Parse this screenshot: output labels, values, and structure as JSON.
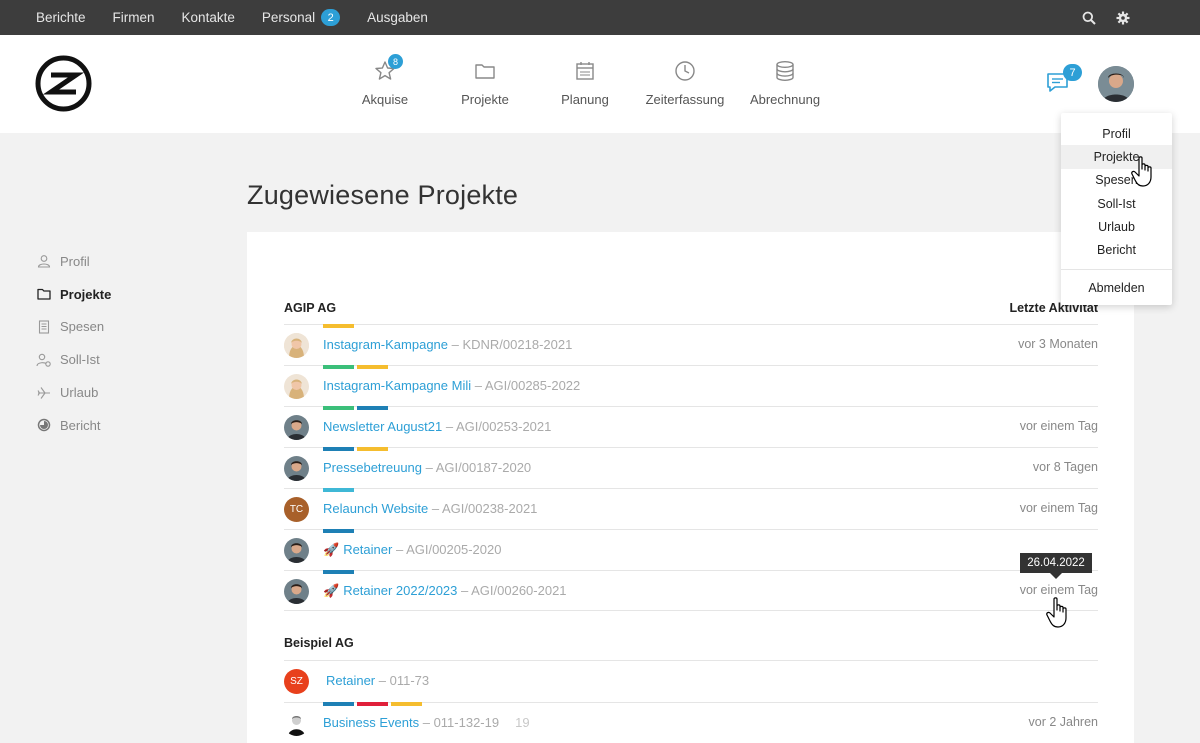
{
  "topnav": {
    "items": [
      {
        "label": "Berichte"
      },
      {
        "label": "Firmen"
      },
      {
        "label": "Kontakte"
      },
      {
        "label": "Personal",
        "badge": "2"
      },
      {
        "label": "Ausgaben"
      }
    ],
    "icons": [
      "search-icon",
      "gear-icon"
    ]
  },
  "mainnav": {
    "items": [
      {
        "label": "Akquise",
        "icon": "star-icon",
        "badge": "8"
      },
      {
        "label": "Projekte",
        "icon": "folder-icon"
      },
      {
        "label": "Planung",
        "icon": "calendar-icon"
      },
      {
        "label": "Zeiterfassung",
        "icon": "clock-icon"
      },
      {
        "label": "Abrechnung",
        "icon": "database-icon"
      }
    ]
  },
  "chat": {
    "badge": "7"
  },
  "sidebar": {
    "items": [
      {
        "label": "Profil",
        "icon": "user-icon"
      },
      {
        "label": "Projekte",
        "icon": "folder-icon",
        "active": true
      },
      {
        "label": "Spesen",
        "icon": "receipt-icon"
      },
      {
        "label": "Soll-Ist",
        "icon": "user-settings-icon"
      },
      {
        "label": "Urlaub",
        "icon": "plane-icon"
      },
      {
        "label": "Bericht",
        "icon": "pie-chart-icon"
      }
    ]
  },
  "page": {
    "title": "Zugewiesene Projekte"
  },
  "groups": [
    {
      "name": "AGIP AG",
      "activity_header": "Letzte Aktivität",
      "rows": [
        {
          "title": "Instagram-Kampagne",
          "ref": " – KDNR/00218-2021",
          "activity": "vor 3 Monaten",
          "avatar": "woman-blonde",
          "tags": [
            "#f5bd2e"
          ]
        },
        {
          "title": "Instagram-Kampagne Mili",
          "ref": " – AGI/00285-2022",
          "activity": "",
          "avatar": "woman-blonde",
          "tags": [
            "#3bbf7a",
            "#f5bd2e"
          ]
        },
        {
          "title": "Newsletter August21",
          "ref": " – AGI/00253-2021",
          "activity": "vor einem Tag",
          "avatar": "man-dark",
          "tags": [
            "#3bbf7a",
            "#1e80b5"
          ]
        },
        {
          "title": "Pressebetreuung",
          "ref": " – AGI/00187-2020",
          "activity": "vor 8 Tagen",
          "avatar": "man-dark",
          "tags": [
            "#1e80b5",
            "#f5bd2e"
          ]
        },
        {
          "title": "Relaunch Website",
          "ref": " – AGI/00238-2021",
          "activity": "vor einem Tag",
          "avatar": "TC",
          "avatar_color": "#a8602a",
          "tags": [
            "#3fb8d6"
          ]
        },
        {
          "title": "Retainer",
          "ref": " – AGI/00205-2020",
          "activity": "",
          "avatar": "man-dark",
          "rocket": "🚀",
          "tags": [
            "#1e80b5"
          ]
        },
        {
          "title": "Retainer 2022/2023",
          "ref": " – AGI/00260-2021",
          "activity": "vor einem Tag",
          "avatar": "man-dark",
          "rocket": "🚀",
          "tags": [
            "#1e80b5"
          ]
        }
      ]
    },
    {
      "name": "Beispiel AG",
      "activity_header": "",
      "rows": [
        {
          "title": "Retainer",
          "ref": " – 011-73",
          "activity": "",
          "avatar": "SZ",
          "avatar_color": "#e8401c",
          "tags": []
        },
        {
          "title": "Business Events",
          "ref": " – 011-132-19",
          "ref_tail": "19",
          "activity": "vor 2 Jahren",
          "avatar": "man-bw",
          "tags": [
            "#1e80b5",
            "#e0203a",
            "#f5bd2e"
          ]
        }
      ]
    }
  ],
  "dropdown": {
    "items": [
      "Profil",
      "Projekte",
      "Spesen",
      "Soll-Ist",
      "Urlaub",
      "Bericht"
    ],
    "logout": "Abmelden"
  },
  "tooltip": {
    "text": "26.04.2022"
  }
}
